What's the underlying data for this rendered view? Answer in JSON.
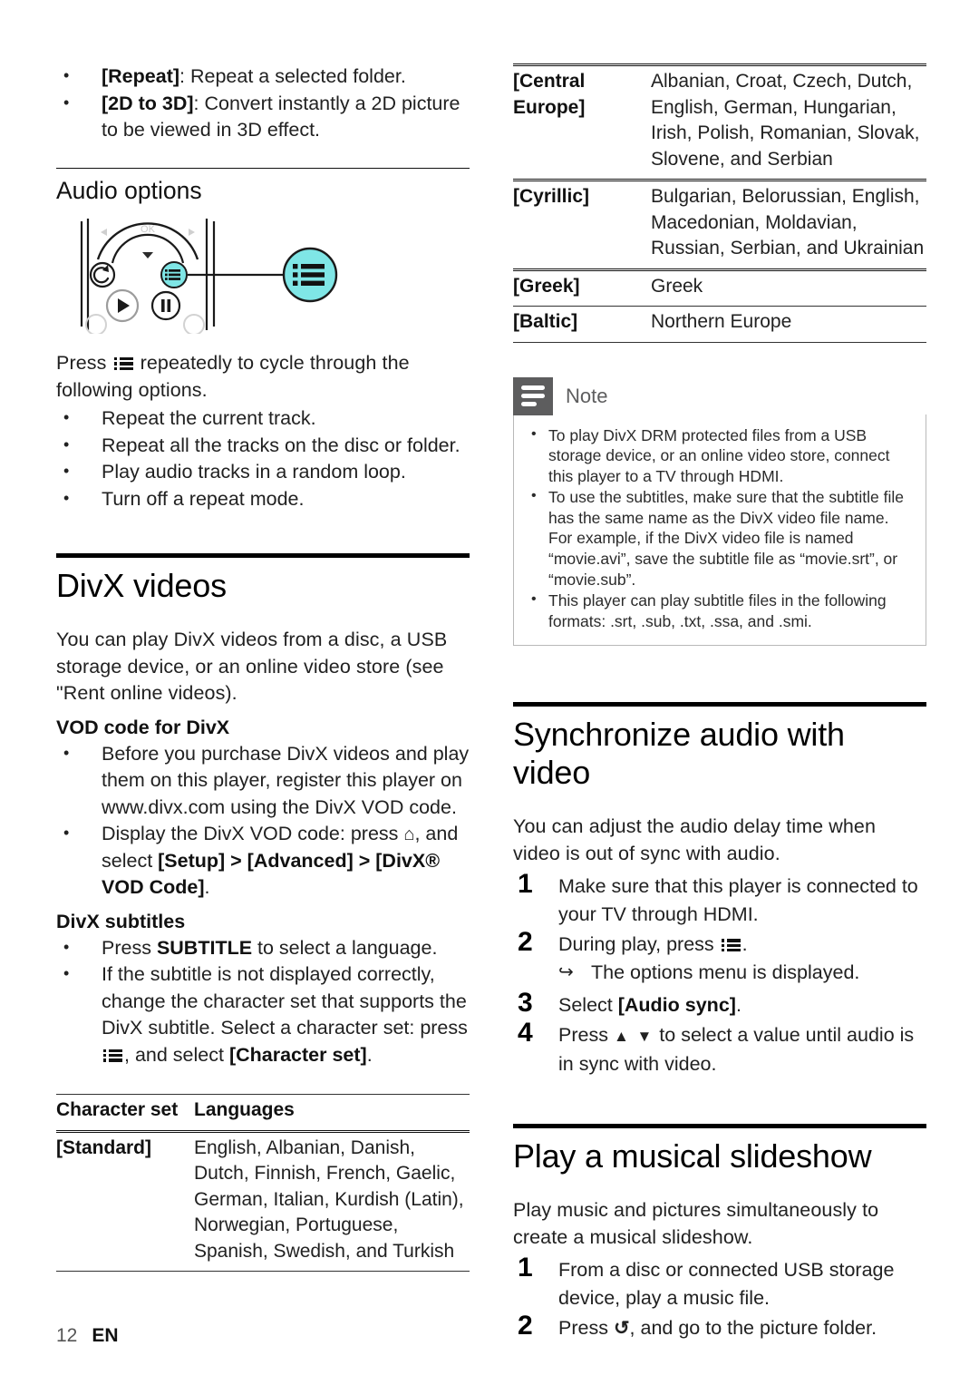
{
  "page": {
    "number": "12",
    "language_code": "EN"
  },
  "left_column": {
    "top_bullets": [
      {
        "label": "[Repeat]",
        "text": ": Repeat a selected folder."
      },
      {
        "label": "[2D to 3D]",
        "text": ": Convert instantly a 2D picture to be viewed in 3D effect."
      }
    ],
    "audio_options": {
      "heading": "Audio options",
      "figure_name": "remote-control-options-button",
      "intro_pre": "Press ",
      "intro_post": " repeatedly to cycle through the following options.",
      "options": [
        "Repeat the current track.",
        "Repeat all the tracks on the disc or folder.",
        "Play audio tracks in a random loop.",
        "Turn off a repeat mode."
      ]
    },
    "divx_videos": {
      "heading": "DivX videos",
      "intro": "You can play DivX videos from a disc, a USB storage device, or an online video store (see \"Rent online videos).",
      "vod_heading": "VOD code for DivX",
      "vod_bullets": [
        "Before you purchase DivX videos and play them on this player, register this player on www.divx.com using the DivX VOD code.",
        "Display the DivX VOD code: press "
      ],
      "vod_bullet2_tail": ", and select ",
      "vod_bullet2_path": "[Setup] > [Advanced] > [DivX® VOD Code]",
      "vod_bullet2_end": ".",
      "subtitles_heading": "DivX subtitles",
      "subtitle_bullet1_pre": "Press ",
      "subtitle_bullet1_bold": "SUBTITLE",
      "subtitle_bullet1_post": " to select a language.",
      "subtitle_bullet2_pre": "If the subtitle is not displayed correctly, change the character set that supports the DivX subtitle. Select a character set: press ",
      "subtitle_bullet2_mid": ", and select ",
      "subtitle_bullet2_bold": "[Character set]",
      "subtitle_bullet2_end": "."
    },
    "charset_table": {
      "headers": [
        "Character set",
        "Languages"
      ],
      "rows": [
        {
          "set": "[Standard]",
          "languages": "English, Albanian, Danish, Dutch, Finnish, French, Gaelic, German, Italian, Kurdish (Latin), Norwegian, Portuguese, Spanish, Swedish, and Turkish"
        }
      ]
    }
  },
  "right_column": {
    "charset_table_cont": {
      "rows": [
        {
          "set": "[Central Europe]",
          "languages": "Albanian, Croat, Czech, Dutch, English, German, Hungarian, Irish, Polish, Romanian, Slovak, Slovene, and Serbian"
        },
        {
          "set": "[Cyrillic]",
          "languages": "Bulgarian, Belorussian, English, Macedonian, Moldavian, Russian, Serbian, and Ukrainian"
        },
        {
          "set": "[Greek]",
          "languages": "Greek"
        },
        {
          "set": "[Baltic]",
          "languages": "Northern Europe"
        }
      ]
    },
    "note": {
      "title": "Note",
      "items": [
        "To play DivX DRM protected files from a USB storage device, or an online video store, connect this player to a TV through HDMI.",
        "To use the subtitles, make sure that the subtitle file has the same name as the DivX video file name. For example, if the DivX video file is named “movie.avi”, save the subtitle file as “movie.srt”, or “movie.sub”.",
        "This player can play subtitle files in the following formats: .srt, .sub, .txt, .ssa, and .smi."
      ]
    },
    "sync_section": {
      "heading": "Synchronize audio with video",
      "intro": "You can adjust the audio delay time when video is out of sync with audio.",
      "steps": [
        {
          "num": "1",
          "text": "Make sure that this player is connected to your TV through HDMI."
        },
        {
          "num": "2",
          "text_pre": "During play, press ",
          "text_post": ".",
          "substep": "The options menu is displayed."
        },
        {
          "num": "3",
          "text_pre": "Select ",
          "bold": "[Audio sync]",
          "text_post": "."
        },
        {
          "num": "4",
          "text_pre": "Press ",
          "arrows": "▲ ▼",
          "text_post": " to select a value until audio is in sync with video."
        }
      ]
    },
    "slideshow_section": {
      "heading": "Play a musical slideshow",
      "intro": "Play music and pictures simultaneously to create a musical slideshow.",
      "steps": [
        {
          "num": "1",
          "text": "From a disc or connected USB storage device, play a music file."
        },
        {
          "num": "2",
          "text_pre": "Press ",
          "glyph": "↺",
          "text_post": ", and go to the picture folder."
        }
      ]
    }
  },
  "colors": {
    "highlight_cyan": "#7FE6E6",
    "note_badge_gray": "#5D5D5E",
    "rule_black": "#000000"
  }
}
